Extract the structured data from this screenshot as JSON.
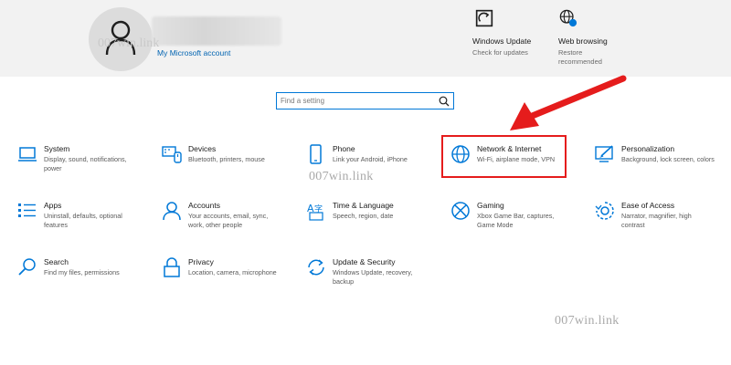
{
  "header": {
    "account_link": "My Microsoft account",
    "quick_links": [
      {
        "title": "Windows Update",
        "subtitle": "Check for updates",
        "icon": "windows-update-icon"
      },
      {
        "title": "Web browsing",
        "subtitle": "Restore\nrecommended",
        "icon": "globe-alert-icon"
      }
    ]
  },
  "search": {
    "placeholder": "Find a setting"
  },
  "tiles": [
    {
      "title": "System",
      "desc": "Display, sound, notifications, power",
      "icon": "laptop-icon"
    },
    {
      "title": "Devices",
      "desc": "Bluetooth, printers, mouse",
      "icon": "devices-icon"
    },
    {
      "title": "Phone",
      "desc": "Link your Android, iPhone",
      "icon": "phone-icon"
    },
    {
      "title": "Network & Internet",
      "desc": "Wi-Fi, airplane mode, VPN",
      "icon": "globe-icon"
    },
    {
      "title": "Personalization",
      "desc": "Background, lock screen, colors",
      "icon": "paintbrush-icon"
    },
    {
      "title": "Apps",
      "desc": "Uninstall, defaults, optional features",
      "icon": "apps-list-icon"
    },
    {
      "title": "Accounts",
      "desc": "Your accounts, email, sync, work, other people",
      "icon": "person-icon"
    },
    {
      "title": "Time & Language",
      "desc": "Speech, region, date",
      "icon": "time-language-icon"
    },
    {
      "title": "Gaming",
      "desc": "Xbox Game Bar, captures, Game Mode",
      "icon": "xbox-icon"
    },
    {
      "title": "Ease of Access",
      "desc": "Narrator, magnifier, high contrast",
      "icon": "ease-of-access-icon"
    },
    {
      "title": "Search",
      "desc": "Find my files, permissions",
      "icon": "search-icon"
    },
    {
      "title": "Privacy",
      "desc": "Location, camera, microphone",
      "icon": "lock-icon"
    },
    {
      "title": "Update & Security",
      "desc": "Windows Update, recovery, backup",
      "icon": "sync-icon"
    }
  ],
  "watermarks": [
    "007win.link",
    "007win.link",
    "007win.link"
  ],
  "colors": {
    "accent": "#0078d7",
    "highlight": "#e51c1c",
    "header_bg": "#f2f2f2"
  }
}
